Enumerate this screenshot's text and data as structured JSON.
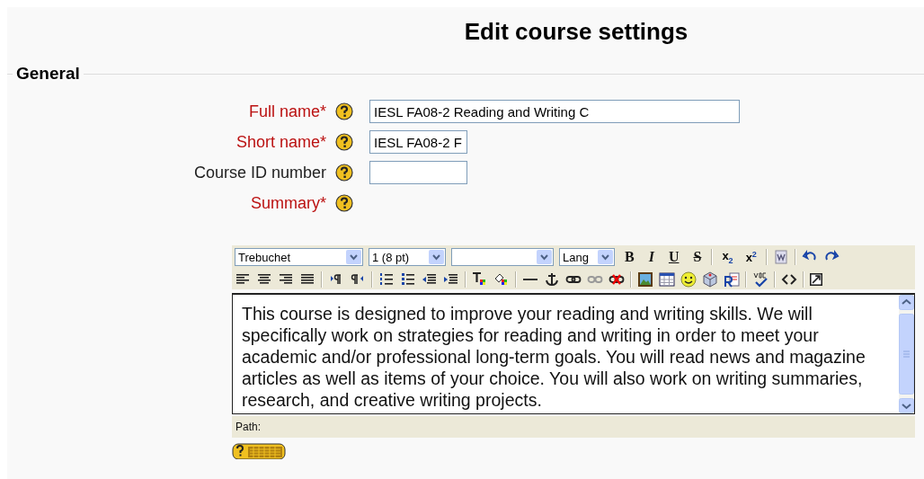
{
  "page_title": "Edit course settings",
  "section": {
    "legend": "General"
  },
  "fields": [
    {
      "kind": "input",
      "label": "Full name*",
      "required": true,
      "value": "IESL FA08-2 Reading and Writing C"
    },
    {
      "kind": "input",
      "label": "Short name*",
      "required": true,
      "value": "IESL FA08-2 F"
    },
    {
      "kind": "input",
      "label": "Course ID number",
      "required": false
    },
    {
      "kind": "editor",
      "label": "Summary*",
      "required": true
    }
  ],
  "editor": {
    "selects": [
      {
        "kind": "dropdown",
        "value": "Trebuchet"
      },
      {
        "kind": "dropdown",
        "value": "1 (8 pt)"
      },
      {
        "kind": "dropdown"
      },
      {
        "kind": "dropdown",
        "value": "Lang"
      }
    ],
    "format_buttons": [
      "B",
      "I",
      "U",
      "S"
    ],
    "script_buttons": [
      "x$_{2}$",
      "x$^{2}$"
    ],
    "content": "This course is designed to improve your reading and writing skills. We will specifically work on strategies for reading and writing in order to meet your academic and/or professional long-term goals. You will read news and magazine articles as well as items of your choice. You will also work on writing summaries, research, and creative writing projects.",
    "path_label": "Path:"
  }
}
